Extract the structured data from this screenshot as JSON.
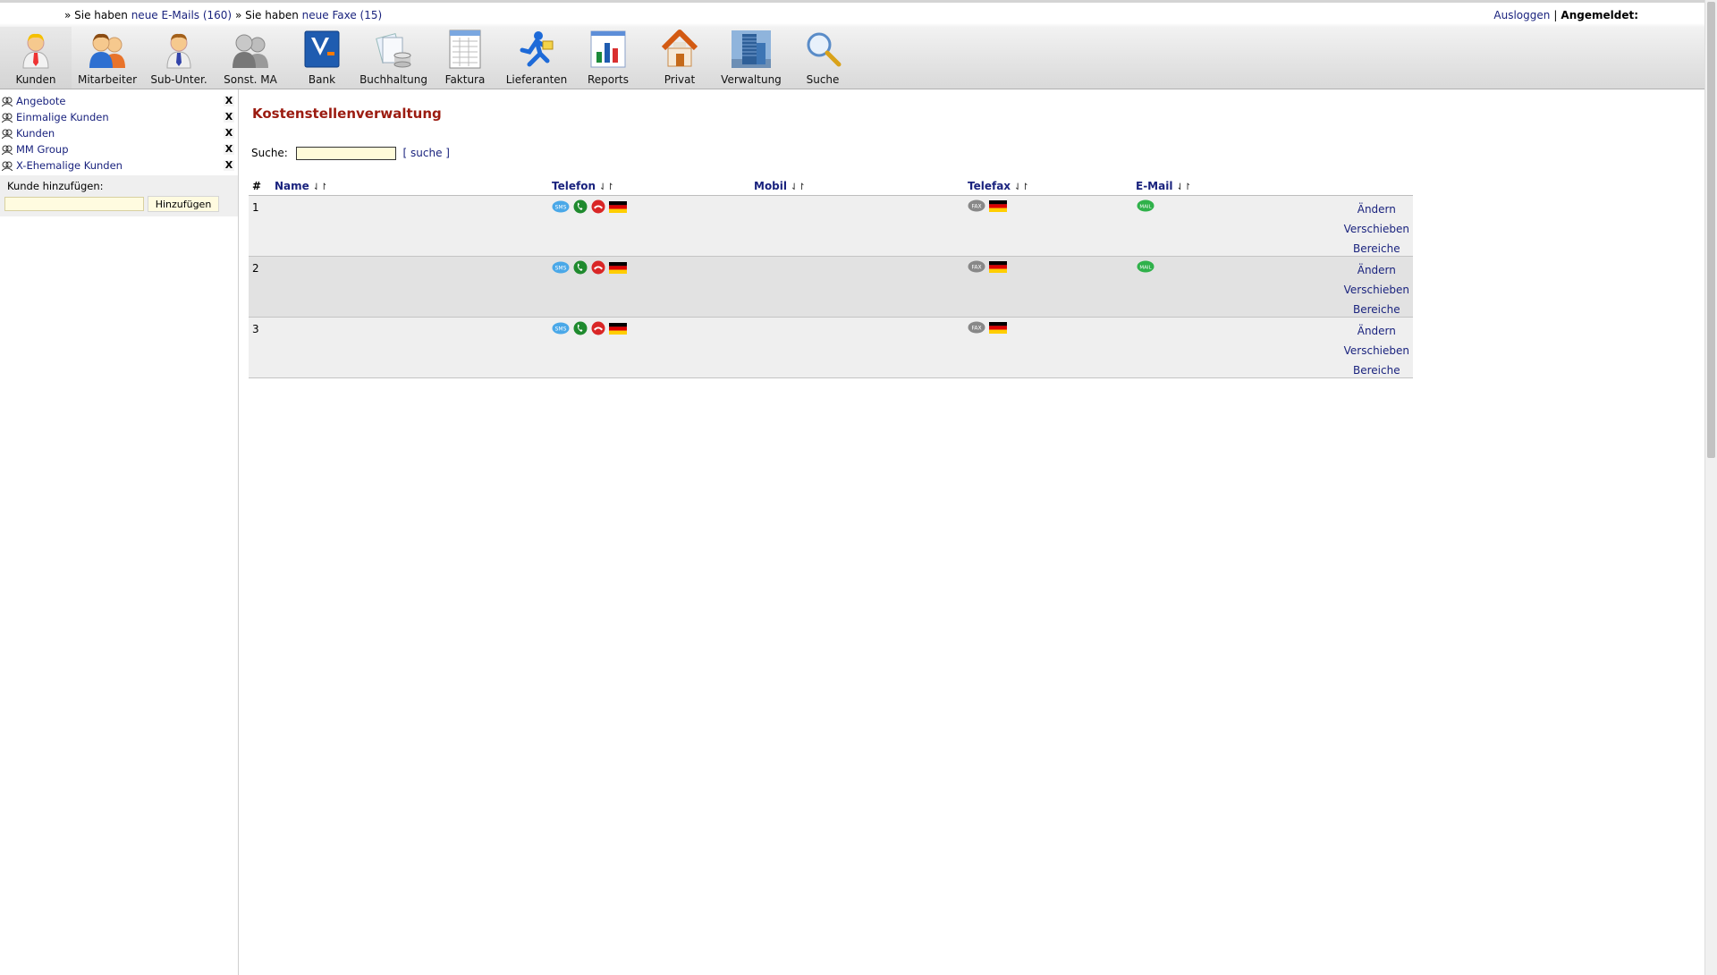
{
  "header": {
    "notice": {
      "prefix1": "» Sie haben",
      "emails_link": "neue E-Mails (160)",
      "prefix2": "» Sie haben",
      "fax_link": "neue Faxe (15)"
    },
    "logout": "Ausloggen",
    "separator": "|",
    "logged_in_label": "Angemeldet:"
  },
  "nav": [
    {
      "label": "Kunden",
      "icon": "user-tie-icon",
      "active": true
    },
    {
      "label": "Mitarbeiter",
      "icon": "users-icon"
    },
    {
      "label": "Sub-Unter.",
      "icon": "user-icon"
    },
    {
      "label": "Sonst. MA",
      "icon": "users-gray-icon"
    },
    {
      "label": "Bank",
      "icon": "bank-logo-icon"
    },
    {
      "label": "Buchhaltung",
      "icon": "accounting-icon"
    },
    {
      "label": "Faktura",
      "icon": "invoice-icon"
    },
    {
      "label": "Lieferanten",
      "icon": "runner-icon"
    },
    {
      "label": "Reports",
      "icon": "report-chart-icon"
    },
    {
      "label": "Privat",
      "icon": "house-icon"
    },
    {
      "label": "Verwaltung",
      "icon": "office-building-icon"
    },
    {
      "label": "Suche",
      "icon": "magnifier-icon"
    }
  ],
  "sidebar": {
    "items": [
      {
        "label": "Angebote"
      },
      {
        "label": "Einmalige Kunden"
      },
      {
        "label": "Kunden"
      },
      {
        "label": "MM Group"
      },
      {
        "label": "X-Ehemalige Kunden"
      }
    ],
    "remove_label": "X",
    "add_label": "Kunde hinzufügen:",
    "add_value": "",
    "add_button": "Hinzufügen"
  },
  "main": {
    "title": "Kostenstellenverwaltung",
    "search_label": "Suche:",
    "search_value": "",
    "search_link": "[ suche ]",
    "columns": [
      "#",
      "Name",
      "Telefon",
      "Mobil",
      "Telefax",
      "E-Mail"
    ],
    "sort_glyph": "⇃↾",
    "rows": [
      {
        "num": "1",
        "has_email": true,
        "actions": [
          "Ändern",
          "Verschieben",
          "Bereiche"
        ]
      },
      {
        "num": "2",
        "has_email": true,
        "actions": [
          "Ändern",
          "Verschieben",
          "Bereiche"
        ]
      },
      {
        "num": "3",
        "has_email": false,
        "actions": [
          "Ändern",
          "Verschieben",
          "Bereiche"
        ]
      }
    ]
  },
  "colors": {
    "title": "#9b1b10",
    "link": "#1a237e",
    "row_bg": "#efefef",
    "row_alt_bg": "#e2e2e2",
    "input_bg": "#fffbd9"
  }
}
